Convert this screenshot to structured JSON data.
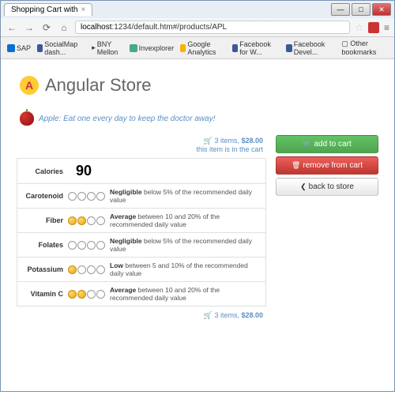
{
  "browser": {
    "tab_title": "Shopping Cart with",
    "url_display": "localhost:1234/default.htm#/products/APL",
    "url_host": "localhost",
    "url_path": ":1234/default.htm#/products/APL",
    "bookmarks": [
      "SAP",
      "SocialMap dash...",
      "BNY Mellon",
      "Invexplorer",
      "Google Analytics",
      "Facebook for W...",
      "Facebook Devel..."
    ],
    "other_bookmarks": "Other bookmarks"
  },
  "page": {
    "title": "Angular Store",
    "product_name": "Apple",
    "product_tagline": "Eat one every day to keep the doctor away!"
  },
  "cart_top": {
    "items_label": "3 items,",
    "price": "$28.00",
    "in_cart": "this item is in the cart"
  },
  "cart_bottom": {
    "items_label": "3 items,",
    "price": "$28.00"
  },
  "buttons": {
    "add": "add to cart",
    "remove": "remove from cart",
    "back": "back to store"
  },
  "nutrition": {
    "calories_label": "Calories",
    "calories_value": "90",
    "rows": [
      {
        "label": "Carotenoid",
        "filled": 0,
        "rating": "Negligible",
        "desc": "below 5% of the recommended daily value"
      },
      {
        "label": "Fiber",
        "filled": 2,
        "rating": "Average",
        "desc": "between 10 and 20% of the recommended daily value"
      },
      {
        "label": "Folates",
        "filled": 0,
        "rating": "Negligible",
        "desc": "below 5% of the recommended daily value"
      },
      {
        "label": "Potassium",
        "filled": 1,
        "rating": "Low",
        "desc": "between 5 and 10% of the recommended daily value"
      },
      {
        "label": "Vitamin C",
        "filled": 2,
        "rating": "Average",
        "desc": "between 10 and 20% of the recommended daily value"
      }
    ]
  }
}
